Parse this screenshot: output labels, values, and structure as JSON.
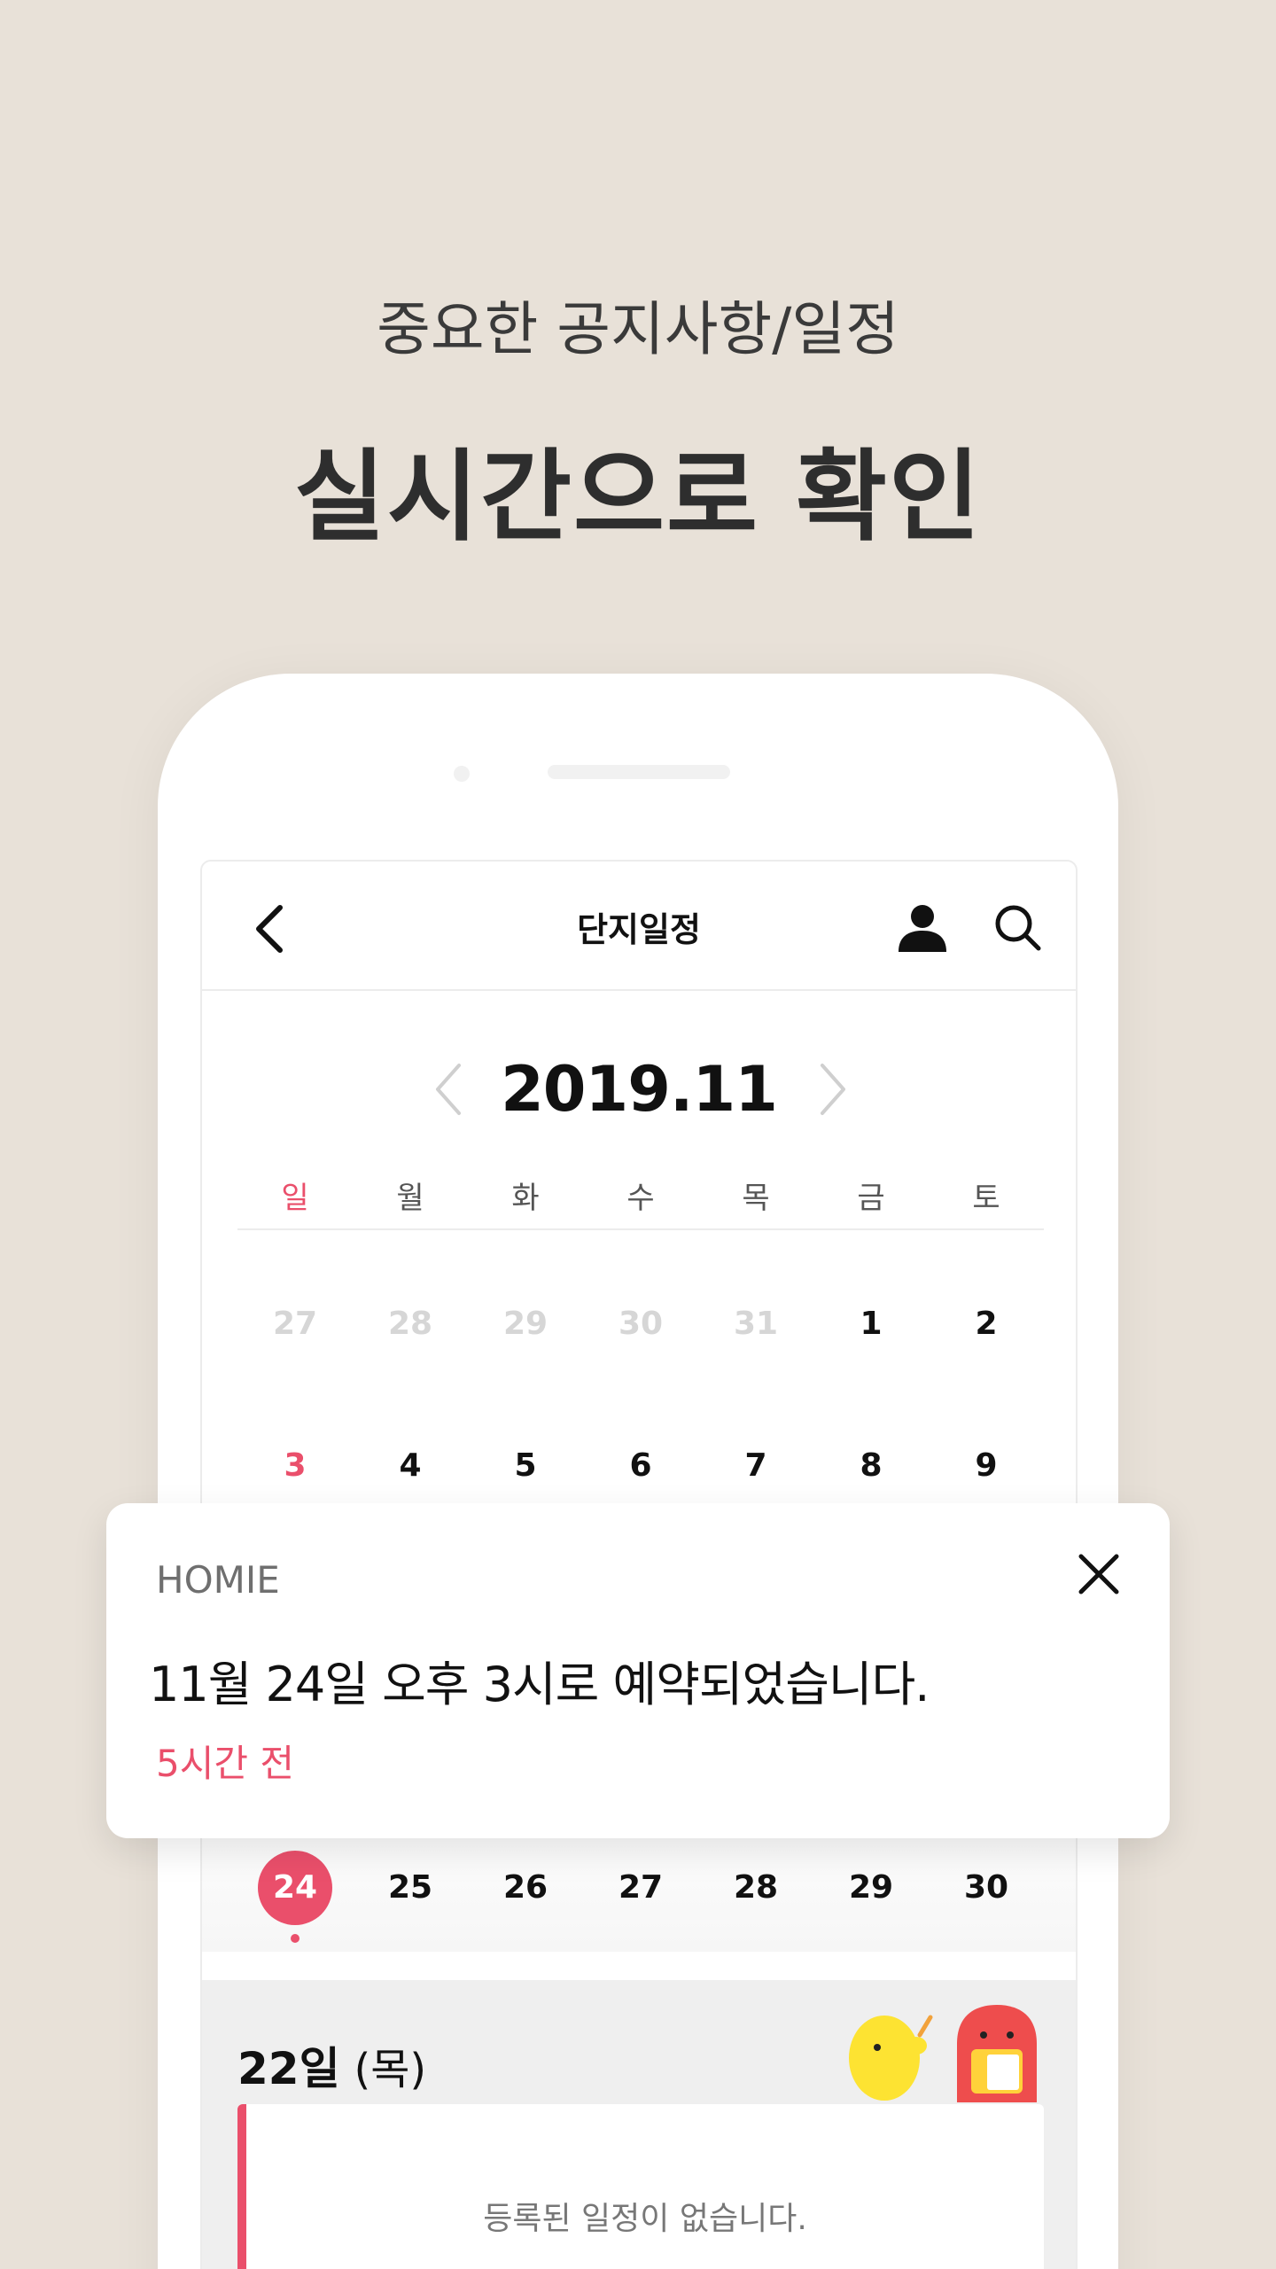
{
  "promo": {
    "subtitle": "중요한 공지사항/일정",
    "title": "실시간으로 확인"
  },
  "header": {
    "title": "단지일정",
    "back_icon": "chevron-left-icon",
    "user_icon": "user-icon",
    "search_icon": "search-icon"
  },
  "calendar": {
    "month_label": "2019.11",
    "weekdays": [
      "일",
      "월",
      "화",
      "수",
      "목",
      "금",
      "토"
    ],
    "rows": [
      [
        "27",
        "28",
        "29",
        "30",
        "31",
        "1",
        "2"
      ],
      [
        "3",
        "4",
        "5",
        "6",
        "7",
        "8",
        "9"
      ],
      [
        "24",
        "25",
        "26",
        "27",
        "28",
        "29",
        "30"
      ]
    ],
    "selected_day": "24"
  },
  "notification": {
    "app_name": "HOMIE",
    "message": "11월 24일 오후 3시로 예약되었습니다.",
    "time": "5시간 전"
  },
  "schedule": {
    "date_day": "22일",
    "date_dow": "(목)",
    "empty_text": "등록된 일정이 없습니다."
  },
  "colors": {
    "accent": "#ea4f6b",
    "background": "#e8e1d8"
  }
}
